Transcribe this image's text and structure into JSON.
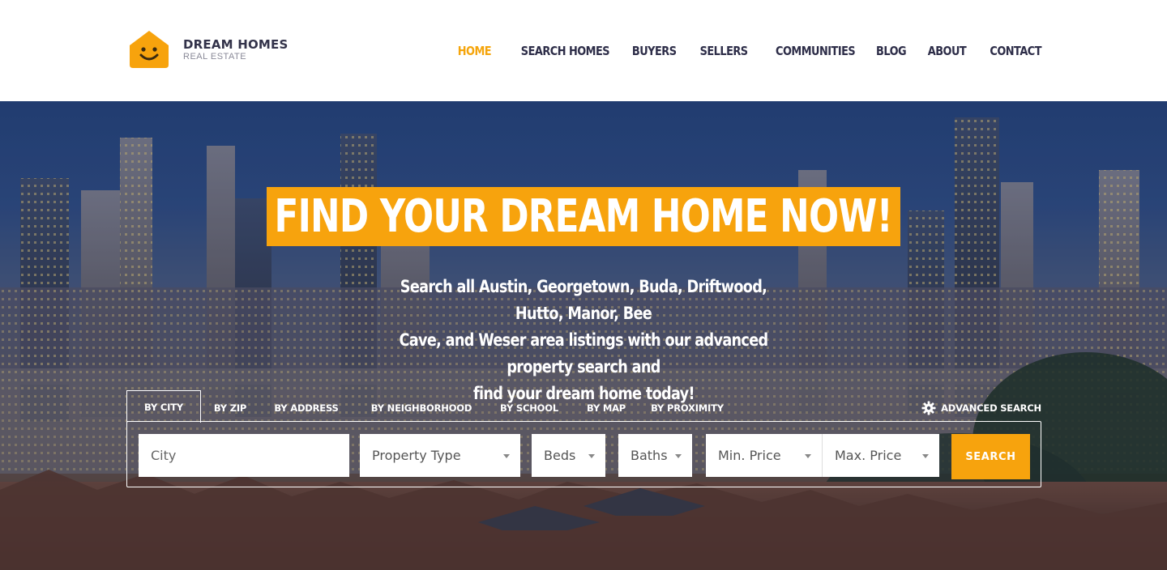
{
  "brand": {
    "name": "DREAM HOMES",
    "tagline": "REAL ESTATE",
    "accent_color": "#f7a30d",
    "logo_icon": "smiling-house-icon"
  },
  "nav": {
    "items": [
      {
        "label": "HOME",
        "active": true
      },
      {
        "label": "SEARCH HOMES",
        "active": false
      },
      {
        "label": "BUYERS",
        "active": false
      },
      {
        "label": "SELLERS",
        "active": false
      },
      {
        "label": "COMMUNITIES",
        "active": false
      },
      {
        "label": "BLOG",
        "active": false
      },
      {
        "label": "ABOUT",
        "active": false
      },
      {
        "label": "CONTACT",
        "active": false
      }
    ]
  },
  "hero": {
    "headline": "FIND YOUR DREAM HOME NOW!",
    "subtext_lines": [
      "Search all Austin, Georgetown, Buda, Driftwood, Hutto, Manor, Bee",
      "Cave, and Weser area listings with our advanced property search and",
      "find your dream home today!"
    ],
    "background": "city-skyline-at-dusk"
  },
  "search": {
    "tabs": [
      {
        "label": "BY CITY",
        "active": true
      },
      {
        "label": "BY ZIP",
        "active": false
      },
      {
        "label": "BY ADDRESS",
        "active": false
      },
      {
        "label": "BY NEIGHBORHOOD",
        "active": false
      },
      {
        "label": "BY SCHOOL",
        "active": false
      },
      {
        "label": "BY MAP",
        "active": false
      },
      {
        "label": "BY PROXIMITY",
        "active": false
      }
    ],
    "advanced_label": "ADVANCED SEARCH",
    "advanced_icon": "gear-icon",
    "fields": {
      "city_placeholder": "City",
      "property_type": "Property Type",
      "beds": "Beds",
      "baths": "Baths",
      "min_price": "Min. Price",
      "max_price": "Max. Price"
    },
    "button_label": "SEARCH"
  }
}
